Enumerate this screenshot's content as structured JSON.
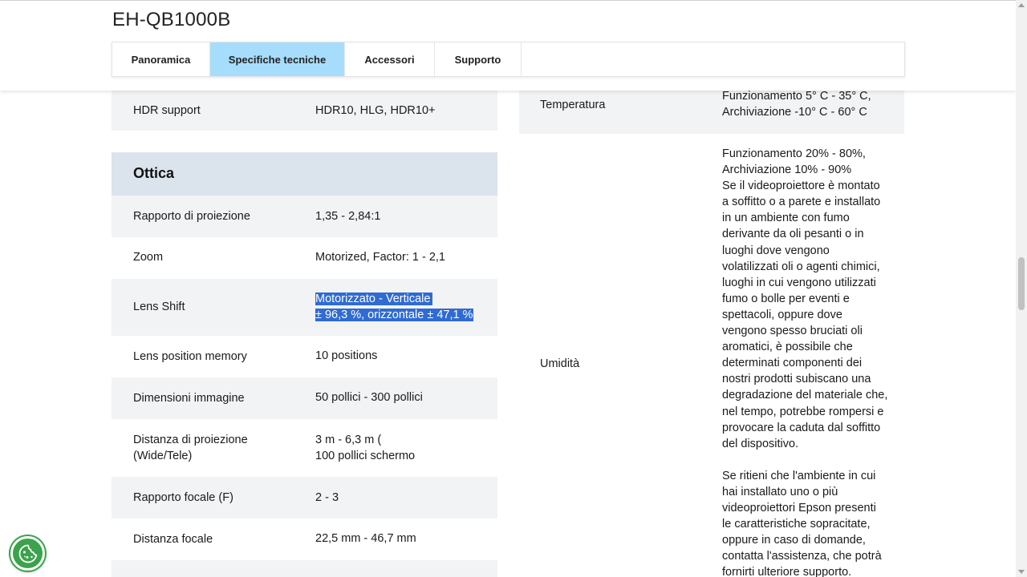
{
  "header": {
    "product_title": "EH-QB1000B",
    "tabs": [
      {
        "label": "Panoramica",
        "active": false
      },
      {
        "label": "Specifiche tecniche",
        "active": true
      },
      {
        "label": "Accessori",
        "active": false
      },
      {
        "label": "Supporto",
        "active": false
      }
    ]
  },
  "left": {
    "hdr": {
      "label": "HDR support",
      "value": "HDR10, HLG, HDR10+"
    },
    "section_title": "Ottica",
    "rows": [
      {
        "label": "Rapporto di proiezione",
        "value": "1,35 - 2,84:1"
      },
      {
        "label": "Zoom",
        "value": "Motorized, Factor: 1 - 2,1"
      },
      {
        "label": "Lens Shift",
        "value_line1": "Motorizzato - Verticale",
        "value_line2": "± 96,3 %, orizzontale ± 47,1 %"
      },
      {
        "label": "Lens position memory",
        "value": "10 positions"
      },
      {
        "label": "Dimensioni immagine",
        "value": "50 pollici - 300 pollici"
      },
      {
        "label_line1": "Distanza di proiezione",
        "label_line2": "(Wide/Tele)",
        "value_line1": "3 m - 6,3 m (",
        "value_line2": "100 pollici schermo"
      },
      {
        "label": "Rapporto focale (F)",
        "value": "2 - 3"
      },
      {
        "label": "Distanza focale",
        "value": "22,5 mm - 46,7 mm"
      }
    ]
  },
  "right": {
    "temperature": {
      "label": "Temperatura",
      "value_line1": "Funzionamento 5° C - 35° C,",
      "value_line2": "Archiviazione -10° C - 60° C"
    },
    "humidity": {
      "label": "Umidità",
      "lines": [
        "Funzionamento 20% - 80%,",
        "Archiviazione 10% - 90%",
        "Se il videoproiettore è montato",
        "a soffitto o a parete e installato",
        "in un ambiente con fumo",
        "derivante da oli pesanti o in",
        "luoghi dove vengono",
        "volatilizzati oli o agenti chimici,",
        "luoghi in cui vengono utilizzati",
        "fumo o bolle per eventi e",
        "spettacoli, oppure dove",
        "vengono spesso bruciati oli",
        "aromatici, è possibile che",
        "determinati componenti dei",
        "nostri prodotti subiscano una",
        "degradazione del materiale che,",
        "nel tempo, potrebbe rompersi e",
        "provocare la caduta dal soffitto",
        "del dispositivo.",
        "",
        "Se ritieni che l'ambiente in cui",
        "hai installato uno o più",
        "videoproiettori Epson presenti",
        "le caratteristiche sopracitate,",
        "oppure in caso di domande,",
        "contatta l'assistenza, che potrà",
        "fornirti ulteriore supporto."
      ]
    }
  },
  "colors": {
    "active_tab": "#a6ddfc",
    "section_header": "#dbe4ec",
    "row_grey": "#f1f3f5",
    "selection": "#2f6bd3",
    "cookie_button": "#3aa34b"
  }
}
